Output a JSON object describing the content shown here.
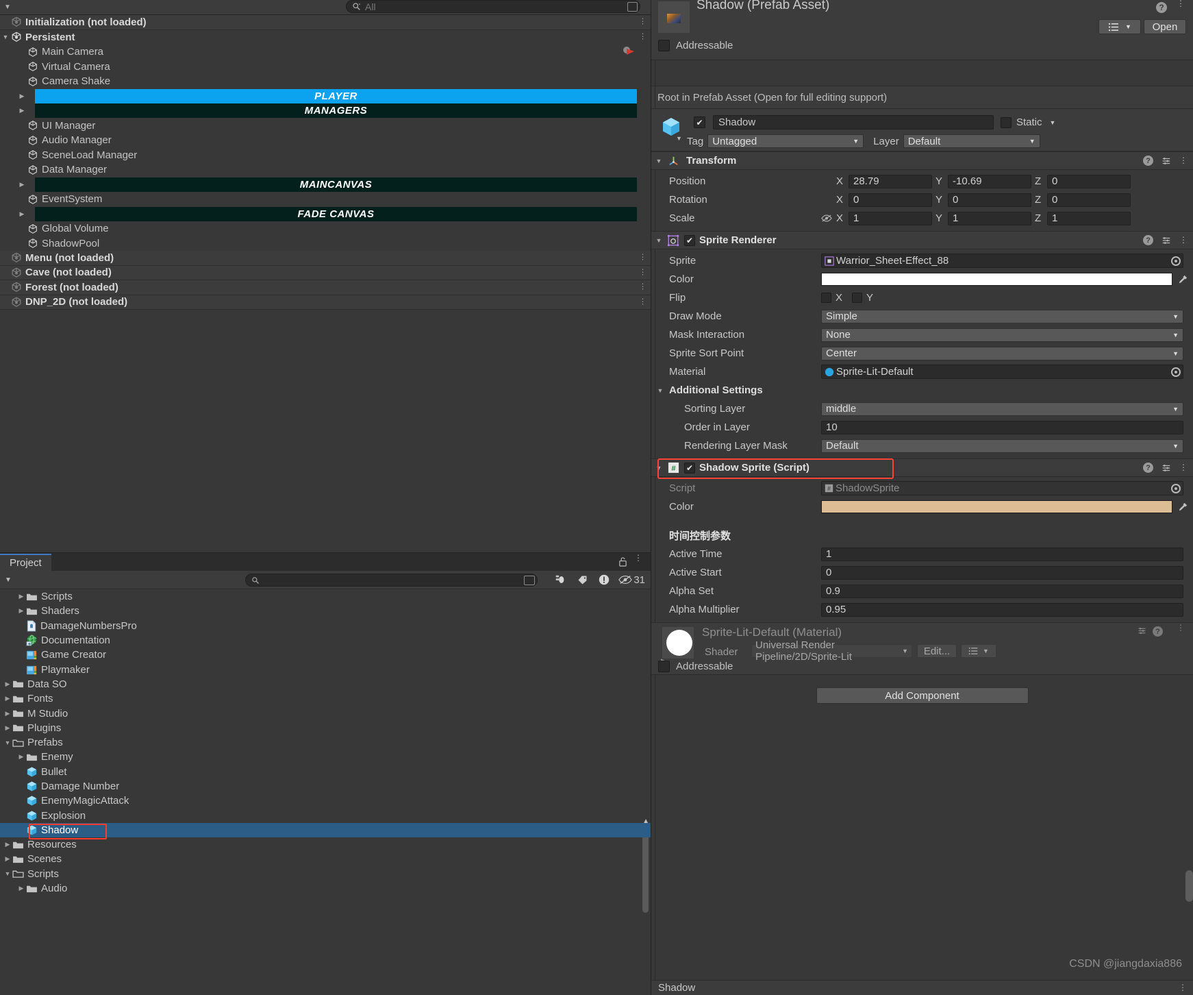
{
  "hierarchy": {
    "search": {
      "placeholder": "All",
      "icon": "search-icon"
    },
    "rows": [
      {
        "label": "Initialization (not loaded)",
        "type": "scene",
        "loaded": false,
        "indent": 0
      },
      {
        "label": "Persistent",
        "type": "scene",
        "loaded": true,
        "indent": 0,
        "expanded": true
      },
      {
        "label": "Main Camera",
        "type": "gameobject",
        "indent": 1
      },
      {
        "label": "Virtual Camera",
        "type": "gameobject",
        "indent": 1
      },
      {
        "label": "Camera Shake",
        "type": "gameobject",
        "indent": 1
      },
      {
        "label": "PLAYER",
        "type": "banner-blue",
        "indent": 1
      },
      {
        "label": "MANAGERS",
        "type": "banner-dark",
        "indent": 1
      },
      {
        "label": "UI Manager",
        "type": "gameobject",
        "indent": 1
      },
      {
        "label": "Audio Manager",
        "type": "gameobject",
        "indent": 1
      },
      {
        "label": "SceneLoad Manager",
        "type": "gameobject",
        "indent": 1
      },
      {
        "label": "Data Manager",
        "type": "gameobject",
        "indent": 1
      },
      {
        "label": "MAINCANVAS",
        "type": "banner-dark",
        "indent": 1
      },
      {
        "label": "EventSystem",
        "type": "gameobject",
        "indent": 1
      },
      {
        "label": "FADE CANVAS",
        "type": "banner-dark",
        "indent": 1
      },
      {
        "label": "Global Volume",
        "type": "gameobject",
        "indent": 1
      },
      {
        "label": "ShadowPool",
        "type": "gameobject",
        "indent": 1
      },
      {
        "label": "Menu (not loaded)",
        "type": "scene",
        "loaded": false,
        "indent": 0
      },
      {
        "label": "Cave (not loaded)",
        "type": "scene",
        "loaded": false,
        "indent": 0
      },
      {
        "label": "Forest (not loaded)",
        "type": "scene",
        "loaded": false,
        "indent": 0
      },
      {
        "label": "DNP_2D (not loaded)",
        "type": "scene",
        "loaded": false,
        "indent": 0
      }
    ]
  },
  "project": {
    "tab_label": "Project",
    "search_placeholder": "",
    "hidden_count": "31",
    "rows": [
      {
        "label": "Scripts",
        "icon": "folder-icon",
        "indent": 1,
        "arrow": true
      },
      {
        "label": "Shaders",
        "icon": "folder-icon",
        "indent": 1,
        "arrow": true
      },
      {
        "label": "DamageNumbersPro",
        "icon": "doc-icon",
        "indent": 1,
        "arrow": false
      },
      {
        "label": "Documentation",
        "icon": "globe-icon",
        "indent": 1,
        "arrow": false
      },
      {
        "label": "Game Creator",
        "icon": "package-icon",
        "indent": 1,
        "arrow": false
      },
      {
        "label": "Playmaker",
        "icon": "package-icon",
        "indent": 1,
        "arrow": false
      },
      {
        "label": "Data SO",
        "icon": "folder-icon",
        "indent": 0,
        "arrow": true
      },
      {
        "label": "Fonts",
        "icon": "folder-icon",
        "indent": 0,
        "arrow": true
      },
      {
        "label": "M Studio",
        "icon": "folder-icon",
        "indent": 0,
        "arrow": true
      },
      {
        "label": "Plugins",
        "icon": "folder-icon",
        "indent": 0,
        "arrow": true
      },
      {
        "label": "Prefabs",
        "icon": "folder-open-icon",
        "indent": 0,
        "arrow": true,
        "expanded": true
      },
      {
        "label": "Enemy",
        "icon": "folder-icon",
        "indent": 1,
        "arrow": true
      },
      {
        "label": "Bullet",
        "icon": "prefab-icon",
        "indent": 1,
        "arrow": false
      },
      {
        "label": "Damage Number",
        "icon": "prefab-icon",
        "indent": 1,
        "arrow": false
      },
      {
        "label": "EnemyMagicAttack",
        "icon": "prefab-icon",
        "indent": 1,
        "arrow": false
      },
      {
        "label": "Explosion",
        "icon": "prefab-icon",
        "indent": 1,
        "arrow": false
      },
      {
        "label": "Shadow",
        "icon": "prefab-icon",
        "indent": 1,
        "arrow": false,
        "selected": true,
        "highlighted": true
      },
      {
        "label": "Resources",
        "icon": "folder-icon",
        "indent": 0,
        "arrow": true
      },
      {
        "label": "Scenes",
        "icon": "folder-icon",
        "indent": 0,
        "arrow": true
      },
      {
        "label": "Scripts",
        "icon": "folder-open-icon",
        "indent": 0,
        "arrow": true,
        "expanded": true
      },
      {
        "label": "Audio",
        "icon": "folder-icon",
        "indent": 1,
        "arrow": true
      }
    ]
  },
  "inspector": {
    "asset_title": "Shadow (Prefab Asset)",
    "open_button": "Open",
    "addressable_label": "Addressable",
    "addressable_checked": false,
    "prefab_note": "Root in Prefab Asset (Open for full editing support)",
    "gameobject": {
      "name": "Shadow",
      "active": true,
      "static_label": "Static",
      "tag_label": "Tag",
      "tag_value": "Untagged",
      "layer_label": "Layer",
      "layer_value": "Default"
    },
    "transform": {
      "title": "Transform",
      "rows": [
        {
          "label": "Position",
          "x": "28.79",
          "y": "-10.69",
          "z": "0"
        },
        {
          "label": "Rotation",
          "x": "0",
          "y": "0",
          "z": "0"
        },
        {
          "label": "Scale",
          "x": "1",
          "y": "1",
          "z": "1",
          "lock": true
        }
      ],
      "axes": [
        "X",
        "Y",
        "Z"
      ]
    },
    "sprite_renderer": {
      "title": "Sprite Renderer",
      "enabled": true,
      "sprite_label": "Sprite",
      "sprite_value": "Warrior_Sheet-Effect_88",
      "color_label": "Color",
      "color_value": "#ffffff",
      "flip_label": "Flip",
      "flip_x_label": "X",
      "flip_y_label": "Y",
      "flip_x": false,
      "flip_y": false,
      "draw_mode_label": "Draw Mode",
      "draw_mode_value": "Simple",
      "mask_interaction_label": "Mask Interaction",
      "mask_interaction_value": "None",
      "sort_point_label": "Sprite Sort Point",
      "sort_point_value": "Center",
      "material_label": "Material",
      "material_value": "Sprite-Lit-Default",
      "additional_settings_label": "Additional Settings",
      "sorting_layer_label": "Sorting Layer",
      "sorting_layer_value": "middle",
      "order_in_layer_label": "Order in Layer",
      "order_in_layer_value": "10",
      "rendering_layer_mask_label": "Rendering Layer Mask",
      "rendering_layer_mask_value": "Default"
    },
    "shadow_sprite": {
      "title": "Shadow Sprite (Script)",
      "enabled": true,
      "script_label": "Script",
      "script_value": "ShadowSprite",
      "color_label": "Color",
      "color_value": "#ddbd93",
      "section_header": "时间控制参数",
      "fields": [
        {
          "label": "Active Time",
          "value": "1"
        },
        {
          "label": "Active Start",
          "value": "0"
        },
        {
          "label": "Alpha Set",
          "value": "0.9"
        },
        {
          "label": "Alpha Multiplier",
          "value": "0.95"
        }
      ]
    },
    "material_preview": {
      "title": "Sprite-Lit-Default (Material)",
      "shader_label": "Shader",
      "shader_value": "Universal Render Pipeline/2D/Sprite-Lit",
      "edit_button": "Edit...",
      "addressable_label": "Addressable",
      "addressable_checked": false
    },
    "add_component_label": "Add Component",
    "status_bar_label": "Shadow"
  },
  "watermark": "CSDN @jiangdaxia886",
  "colors": {
    "selection_blue": "#0ba2ef",
    "banner_dark": "#04201d",
    "project_selected": "#2c5d87",
    "highlight_red": "#ff4136",
    "script_color_swatch": "#ddbd93"
  }
}
